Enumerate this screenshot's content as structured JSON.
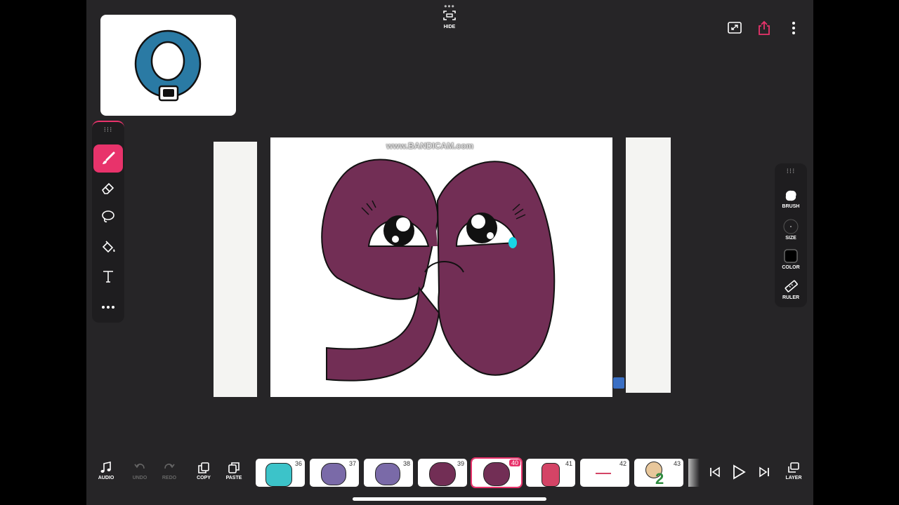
{
  "top": {
    "hide_label": "HIDE",
    "icons": [
      "fullscreen-icon",
      "share-icon",
      "more-vertical-icon"
    ],
    "accent": "#e8336b"
  },
  "left_tools": [
    "brush-icon",
    "eraser-icon",
    "lasso-icon",
    "fill-bucket-icon",
    "text-tool-icon",
    "more-horizontal-icon"
  ],
  "right_panel": {
    "brush_label": "BRUSH",
    "size_label": "SIZE",
    "color_label": "COLOR",
    "ruler_label": "RULER"
  },
  "canvas": {
    "watermark": "www.BANDICAM.com",
    "character_color": "#722e55"
  },
  "bottom": {
    "audio_label": "AUDIO",
    "undo_label": "UNDO",
    "redo_label": "REDO",
    "copy_label": "COPY",
    "paste_label": "PASTE",
    "layer_label": "LAYER",
    "frames": [
      {
        "number": "36"
      },
      {
        "number": "37"
      },
      {
        "number": "38"
      },
      {
        "number": "39"
      },
      {
        "number": "40",
        "current": true
      },
      {
        "number": "41"
      },
      {
        "number": "42"
      },
      {
        "number": "43"
      }
    ]
  }
}
